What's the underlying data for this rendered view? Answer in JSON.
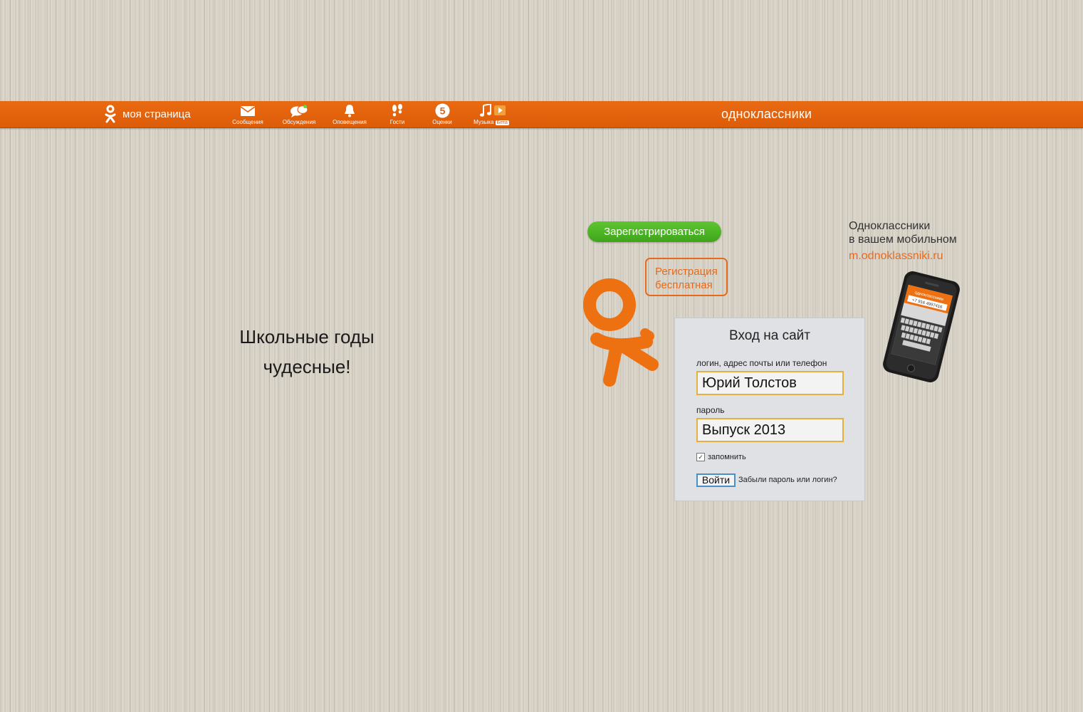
{
  "topbar": {
    "my_page": "моя страница",
    "nav": [
      {
        "label": "Сообщения",
        "icon": "envelope-icon"
      },
      {
        "label": "Обсуждения",
        "icon": "chat-bubbles-icon"
      },
      {
        "label": "Оповещения",
        "icon": "bell-icon"
      },
      {
        "label": "Гости",
        "icon": "footprints-icon"
      },
      {
        "label": "Оценки",
        "icon": "five-badge-icon"
      },
      {
        "label": "Музыка",
        "icon": "music-note-icon",
        "badge": "Бета"
      }
    ],
    "brand": "одноклассники",
    "colors": {
      "bar": "#e36310",
      "notify_dot": "#6fd13a"
    }
  },
  "slogan": [
    "Школьные годы",
    "чудесные!"
  ],
  "register": {
    "button_label": "Зарегистрироваться",
    "bubble_lines": [
      "Регистрация",
      "бесплатная"
    ],
    "button_color": "#4cb526"
  },
  "login": {
    "title": "Вход на сайт",
    "login_label": "логин, адрес почты или телефон",
    "login_value": "Юрий Толстов",
    "password_label": "пароль",
    "password_value": "Выпуск 2013",
    "remember_label": "запомнить",
    "remember_checked": true,
    "submit_label": "Войти",
    "forgot_link": "Забыли пароль или логин?"
  },
  "mobile": {
    "line1": "Одноклассники",
    "line2": "в вашем мобильном",
    "link": "m.odnoklassniki.ru",
    "phone_screen_title": "одноклассники",
    "phone_screen_number": "+7 916 4997416"
  }
}
